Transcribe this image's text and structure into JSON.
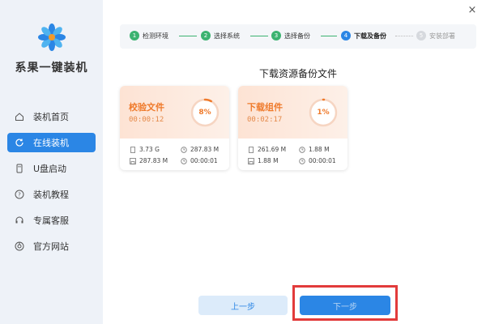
{
  "app": {
    "name": "系果一键装机"
  },
  "window": {
    "close_glyph": "×"
  },
  "sidebar": {
    "items": [
      {
        "label": "装机首页",
        "icon": "home-icon",
        "active": false
      },
      {
        "label": "在线装机",
        "icon": "refresh-icon",
        "active": true
      },
      {
        "label": "U盘启动",
        "icon": "usb-icon",
        "active": false
      },
      {
        "label": "装机教程",
        "icon": "help-icon",
        "active": false
      },
      {
        "label": "专属客服",
        "icon": "headset-icon",
        "active": false
      },
      {
        "label": "官方网站",
        "icon": "browser-icon",
        "active": false
      }
    ]
  },
  "stepper": {
    "steps": [
      {
        "num": "1",
        "label": "检测环境",
        "state": "done"
      },
      {
        "num": "2",
        "label": "选择系统",
        "state": "done"
      },
      {
        "num": "3",
        "label": "选择备份",
        "state": "done"
      },
      {
        "num": "4",
        "label": "下载及备份",
        "state": "current"
      },
      {
        "num": "5",
        "label": "安装部署",
        "state": "pending"
      }
    ]
  },
  "main": {
    "title": "下载资源备份文件",
    "cards": [
      {
        "title": "校验文件",
        "time": "00:00:12",
        "progress_label": "8%",
        "progress": 0.08,
        "stats": {
          "size_total": "3.73 G",
          "speed": "287.83 M",
          "size_done": "287.83 M",
          "remaining": "00:00:01"
        }
      },
      {
        "title": "下载组件",
        "time": "00:02:17",
        "progress_label": "1%",
        "progress": 0.01,
        "stats": {
          "size_total": "261.69 M",
          "speed": "1.88 M",
          "size_done": "1.88 M",
          "remaining": "00:00:01"
        }
      }
    ]
  },
  "footer": {
    "prev_label": "上一步",
    "next_label": "下一步"
  },
  "colors": {
    "accent": "#2b86e5",
    "step_done": "#3cb371",
    "card_orange": "#ef7a2b",
    "highlight": "#e23b3b"
  }
}
